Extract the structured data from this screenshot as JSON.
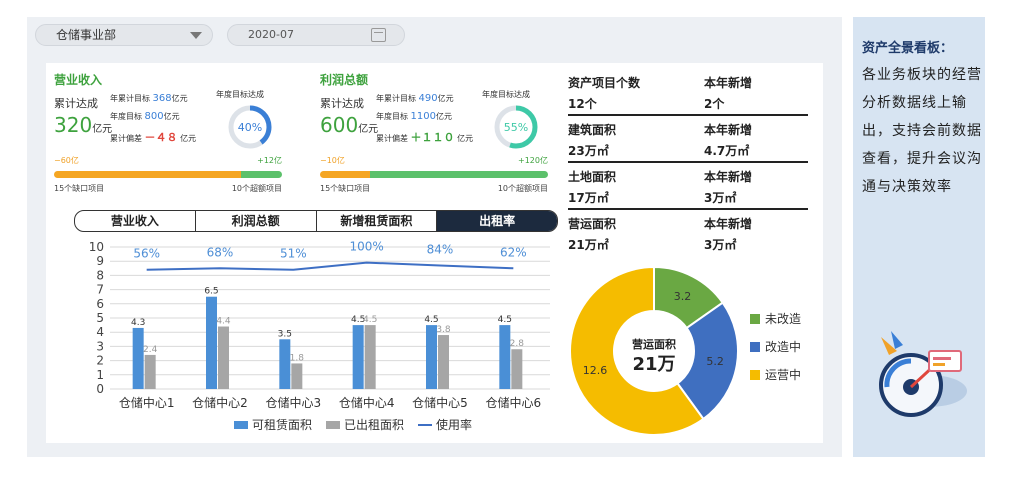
{
  "filters": {
    "department": "仓储事业部",
    "date": "2020-07"
  },
  "kpis": [
    {
      "title": "营业收入",
      "cum_label": "累计达成",
      "cum_value": "320",
      "cum_unit": "亿元",
      "rows": [
        {
          "label": "年累计目标",
          "value": "368",
          "unit": "亿元"
        },
        {
          "label": "年度目标",
          "value": "800",
          "unit": "亿元"
        },
        {
          "label": "累计偏差",
          "value": "－４８",
          "unit": "亿元"
        }
      ],
      "ring_label": "年度目标达成",
      "ring_value": "40%",
      "ring_pct": 40,
      "ring_color": "#3a7fd6",
      "bar_left": "−60亿",
      "bar_right": "+12亿",
      "foot_left": "15个缺口项目",
      "foot_right": "10个超额项目"
    },
    {
      "title": "利润总额",
      "cum_label": "累计达成",
      "cum_value": "600",
      "cum_unit": "亿元",
      "rows": [
        {
          "label": "年累计目标",
          "value": "490",
          "unit": "亿元"
        },
        {
          "label": "年度目标",
          "value": "1100",
          "unit": "亿元"
        },
        {
          "label": "累计偏差",
          "value": "＋１１０",
          "unit": "亿元"
        }
      ],
      "ring_label": "年度目标达成",
      "ring_value": "55%",
      "ring_pct": 55,
      "ring_color": "#3ec9a7",
      "bar_left": "−10亿",
      "bar_right": "+120亿",
      "foot_left": "15个缺口项目",
      "foot_right": "10个超额项目"
    }
  ],
  "tabs": [
    {
      "label": "营业收入",
      "active": false
    },
    {
      "label": "利润总额",
      "active": false
    },
    {
      "label": "新增租赁面积",
      "active": false
    },
    {
      "label": "出租率",
      "active": true
    }
  ],
  "chart_data": {
    "type": "bar",
    "categories": [
      "仓储中心1",
      "仓储中心2",
      "仓储中心3",
      "仓储中心4",
      "仓储中心5",
      "仓储中心6"
    ],
    "series": [
      {
        "name": "可租赁面积",
        "values": [
          4.3,
          6.5,
          3.5,
          4.5,
          4.5,
          4.5
        ],
        "color": "#4a8fd6"
      },
      {
        "name": "已出租面积",
        "values": [
          2.4,
          4.4,
          1.8,
          4.5,
          3.8,
          2.8
        ],
        "color": "#a6a6a6"
      }
    ],
    "line": {
      "name": "使用率",
      "labels": [
        "56%",
        "68%",
        "51%",
        "100%",
        "84%",
        "62%"
      ],
      "values": [
        8.4,
        8.5,
        8.4,
        8.9,
        8.7,
        8.5
      ],
      "color": "#3e6fc4"
    },
    "ylim": [
      0,
      10
    ],
    "yticks": [
      "0",
      "1",
      "2",
      "3",
      "4",
      "5",
      "6",
      "7",
      "8",
      "9",
      "10"
    ],
    "grid": true,
    "legend": "bottom"
  },
  "assets": [
    {
      "h1": "资产项目个数",
      "v1": "12个",
      "h2": "本年新增",
      "v2": "2个"
    },
    {
      "h1": "建筑面积",
      "v1": "23万㎡",
      "h2": "本年新增",
      "v2": "4.7万㎡"
    },
    {
      "h1": "土地面积",
      "v1": "17万㎡",
      "h2": "本年新增",
      "v2": "3万㎡"
    },
    {
      "h1": "营运面积",
      "v1": "21万㎡",
      "h2": "本年新增",
      "v2": "3万㎡"
    }
  ],
  "donut": {
    "center_label": "营运面积",
    "center_value": "21万",
    "segments": [
      {
        "name": "未改造",
        "value": 3.2,
        "color": "#6aa843"
      },
      {
        "name": "改造中",
        "value": 5.2,
        "color": "#3f6fc0"
      },
      {
        "name": "运营中",
        "value": 12.6,
        "color": "#f5bc00"
      }
    ]
  },
  "side": {
    "title": "资产全景看板：",
    "body": "各业务板块的经营分析数据线上输出，支持会前数据查看，提升会议沟通与决策效率"
  }
}
